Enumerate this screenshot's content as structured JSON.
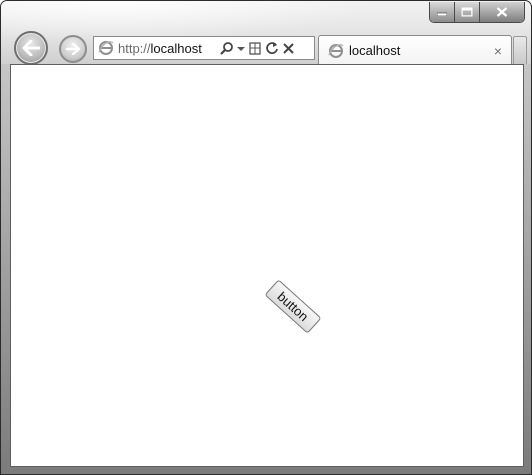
{
  "browser": {
    "address_bar": {
      "url_protocol": "http://",
      "url_host": "localhost"
    },
    "tab": {
      "title": "localhost",
      "close_glyph": "×"
    }
  },
  "page": {
    "button_label": "button",
    "button_rotation_deg": 42
  },
  "icons": [
    "back-arrow-icon",
    "forward-arrow-icon",
    "ie-logo-icon",
    "search-icon",
    "dropdown-icon",
    "compatibility-view-icon",
    "refresh-icon",
    "stop-icon",
    "minimize-icon",
    "maximize-icon",
    "close-icon"
  ]
}
